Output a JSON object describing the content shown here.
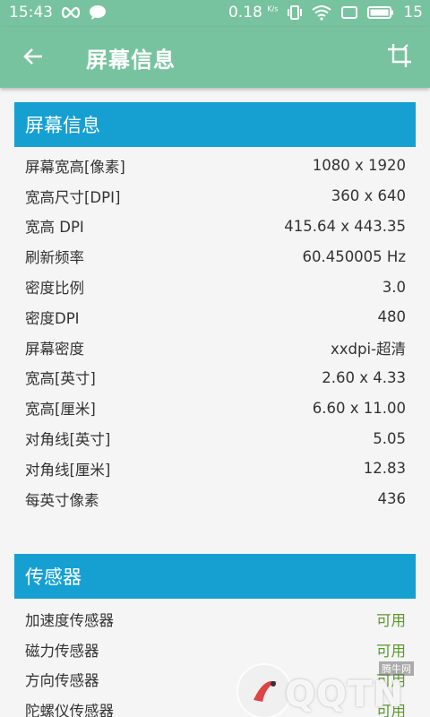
{
  "status_bar": {
    "time": "15:43",
    "speed": "0.18",
    "speed_unit": "K/s",
    "battery": "15"
  },
  "app_bar": {
    "title": "屏幕信息",
    "back_icon": "arrow-left-icon",
    "crop_icon": "crop-icon"
  },
  "screen_section": {
    "header": "屏幕信息",
    "rows": [
      {
        "label": "屏幕宽高[像素]",
        "value": "1080 x 1920"
      },
      {
        "label": "宽高尺寸[DPI]",
        "value": "360 x 640"
      },
      {
        "label": "宽高 DPI",
        "value": "415.64 x 443.35"
      },
      {
        "label": "刷新频率",
        "value": "60.450005 Hz"
      },
      {
        "label": "密度比例",
        "value": "3.0"
      },
      {
        "label": "密度DPI",
        "value": "480"
      },
      {
        "label": "屏幕密度",
        "value": "xxdpi-超清"
      },
      {
        "label": "宽高[英寸]",
        "value": "2.60 x 4.33"
      },
      {
        "label": "宽高[厘米]",
        "value": "6.60 x 11.00"
      },
      {
        "label": "对角线[英寸]",
        "value": "5.05"
      },
      {
        "label": "对角线[厘米]",
        "value": "12.83"
      },
      {
        "label": "每英寸像素",
        "value": "436"
      }
    ]
  },
  "sensor_section": {
    "header": "传感器",
    "rows": [
      {
        "label": "加速度传感器",
        "value": "可用"
      },
      {
        "label": "磁力传感器",
        "value": "可用"
      },
      {
        "label": "方向传感器",
        "value": "可用"
      },
      {
        "label": "陀螺仪传感器",
        "value": "可用"
      }
    ]
  },
  "watermark": {
    "text": "QQTN",
    "small": "腾牛网"
  },
  "colors": {
    "app_bar": "#78c39f",
    "section_header": "#16a0d2",
    "available": "#5a9a2a"
  }
}
